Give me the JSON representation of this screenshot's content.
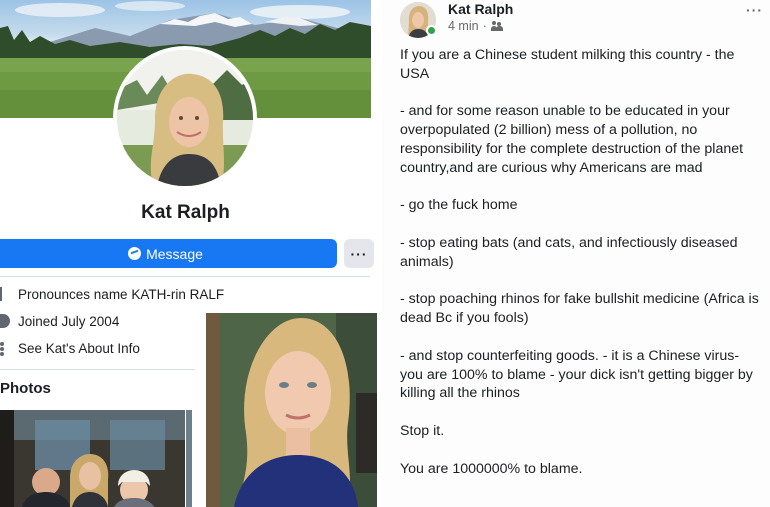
{
  "profile": {
    "name": "Kat Ralph",
    "message_button": "Message",
    "more_button": "···",
    "intro": [
      {
        "icon": "pronunciation-icon",
        "text": "Pronounces name KATH-rin RALF"
      },
      {
        "icon": "clock-icon",
        "text": "Joined July 2004"
      },
      {
        "icon": "more-info-icon",
        "text": "See Kat's About Info"
      }
    ],
    "photos_title": "Photos"
  },
  "post": {
    "author": "Kat Ralph",
    "time": "4 min",
    "separator": "·",
    "audience_icon": "friends-icon",
    "menu": "···",
    "paragraphs": [
      "If you are a Chinese student milking this country - the USA",
      "- and for some reason unable to be educated in your overpopulated (2 billion) mess of a pollution, no responsibility for the complete destruction of the planet country,and are curious why Americans are mad",
      "- go the fuck home",
      " - stop eating bats (and cats, and infectiously diseased animals)",
      " - stop poaching rhinos for fake bullshit medicine (Africa is dead Bc if you fools)",
      "- and stop counterfeiting goods. - it is a Chinese virus- you are 100% to blame - your dick isn't getting bigger by killing all the rhinos",
      "Stop it.",
      "You are 1000000% to blame."
    ]
  },
  "colors": {
    "brand_blue": "#1877f2",
    "online_green": "#31a24c",
    "text": "#1c1e21",
    "secondary_text": "#65676b"
  }
}
